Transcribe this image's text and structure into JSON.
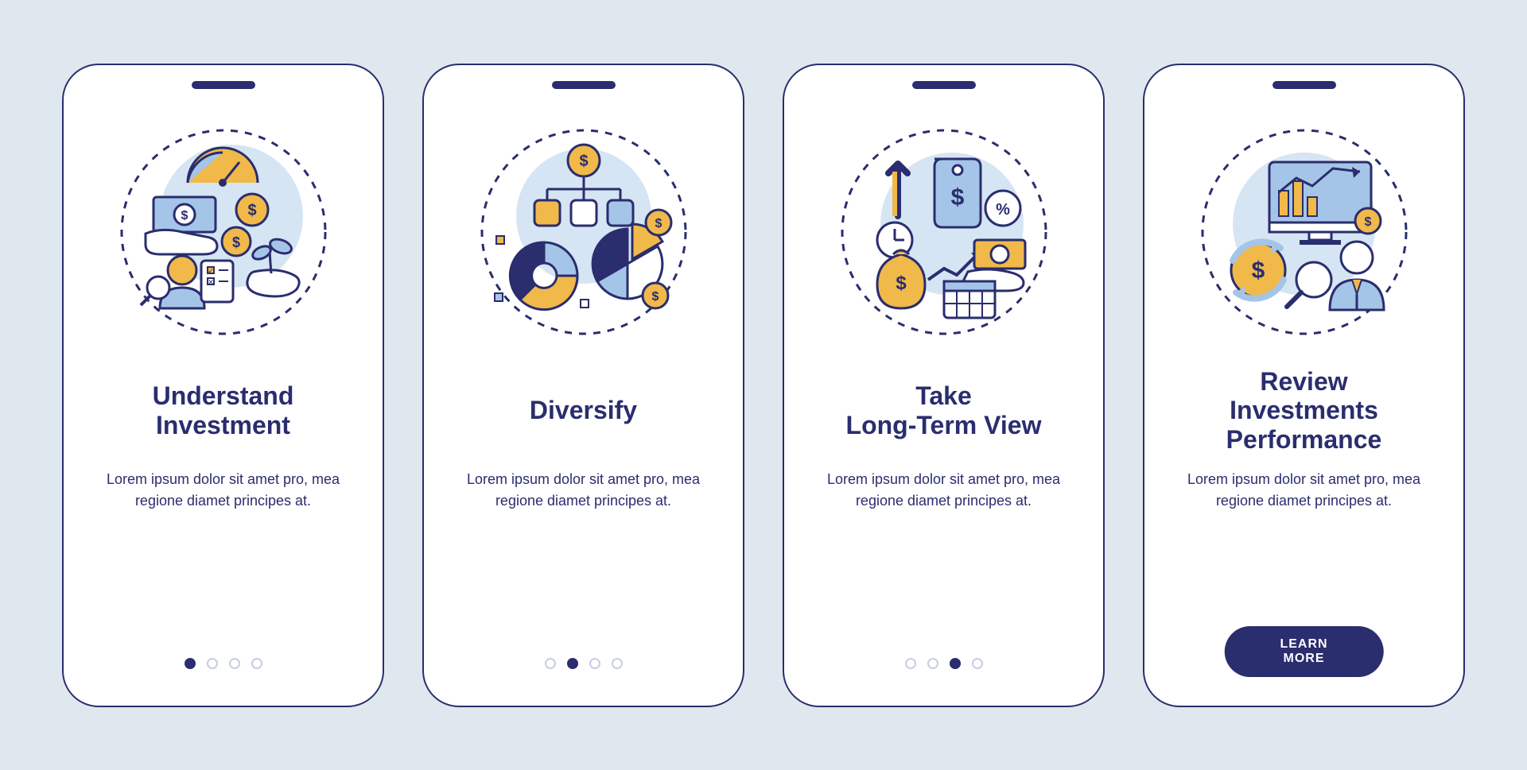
{
  "colors": {
    "primary": "#2a2d6e",
    "accent": "#f0b94a",
    "light_blue": "#a5c5e8",
    "pale_blue": "#d6e5f3",
    "background": "#dfe8ee",
    "card_bg": "#ffffff",
    "dot_inactive": "#c8cde0"
  },
  "cards": [
    {
      "title": "Understand\nInvestment",
      "body": "Lorem ipsum dolor sit amet pro, mea regione diamet principes at.",
      "illustration": "understand-investment-icon",
      "active_index": 0,
      "dot_count": 4,
      "cta": null
    },
    {
      "title": "Diversify",
      "body": "Lorem ipsum dolor sit amet pro, mea regione diamet principes at.",
      "illustration": "diversify-icon",
      "active_index": 1,
      "dot_count": 4,
      "cta": null
    },
    {
      "title": "Take\nLong-Term View",
      "body": "Lorem ipsum dolor sit amet pro, mea regione diamet principes at.",
      "illustration": "long-term-view-icon",
      "active_index": 2,
      "dot_count": 4,
      "cta": null
    },
    {
      "title": "Review\nInvestments\nPerformance",
      "body": "Lorem ipsum dolor sit amet pro, mea regione diamet principes at.",
      "illustration": "review-performance-icon",
      "active_index": 3,
      "dot_count": 4,
      "cta": "LEARN MORE"
    }
  ]
}
